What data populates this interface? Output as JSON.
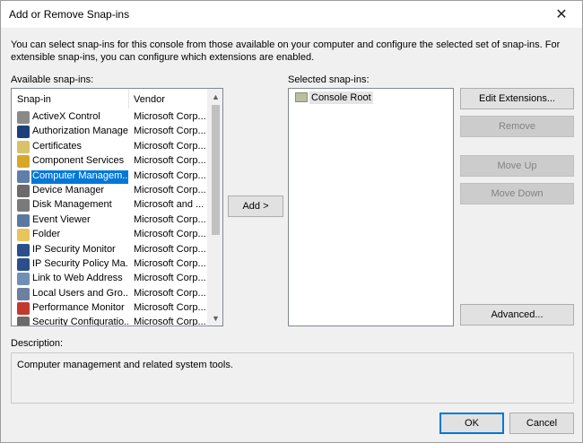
{
  "window": {
    "title": "Add or Remove Snap-ins",
    "close_glyph": "✕"
  },
  "intro": "You can select snap-ins for this console from those available on your computer and configure the selected set of snap-ins. For extensible snap-ins, you can configure which extensions are enabled.",
  "available": {
    "label": "Available snap-ins:",
    "columns": {
      "snapin": "Snap-in",
      "vendor": "Vendor"
    },
    "items": [
      {
        "name": "ActiveX Control",
        "vendor": "Microsoft Corp...",
        "icon": "activex-icon",
        "color": "#8a8a8a"
      },
      {
        "name": "Authorization Manager",
        "vendor": "Microsoft Corp...",
        "icon": "authorization-icon",
        "color": "#1f3f7a"
      },
      {
        "name": "Certificates",
        "vendor": "Microsoft Corp...",
        "icon": "certificate-icon",
        "color": "#d8c26a"
      },
      {
        "name": "Component Services",
        "vendor": "Microsoft Corp...",
        "icon": "component-icon",
        "color": "#d8a72a"
      },
      {
        "name": "Computer Managem...",
        "vendor": "Microsoft Corp...",
        "icon": "computer-management-icon",
        "color": "#5f7fa8"
      },
      {
        "name": "Device Manager",
        "vendor": "Microsoft Corp...",
        "icon": "device-manager-icon",
        "color": "#6b6b6b"
      },
      {
        "name": "Disk Management",
        "vendor": "Microsoft and ...",
        "icon": "disk-icon",
        "color": "#7a7a7a"
      },
      {
        "name": "Event Viewer",
        "vendor": "Microsoft Corp...",
        "icon": "event-viewer-icon",
        "color": "#5a78a0"
      },
      {
        "name": "Folder",
        "vendor": "Microsoft Corp...",
        "icon": "folder-icon",
        "color": "#e8c55a"
      },
      {
        "name": "IP Security Monitor",
        "vendor": "Microsoft Corp...",
        "icon": "ip-security-monitor-icon",
        "color": "#2c4f8c"
      },
      {
        "name": "IP Security Policy Ma...",
        "vendor": "Microsoft Corp...",
        "icon": "ip-security-policy-icon",
        "color": "#2c4f8c"
      },
      {
        "name": "Link to Web Address",
        "vendor": "Microsoft Corp...",
        "icon": "web-link-icon",
        "color": "#6f8fb4"
      },
      {
        "name": "Local Users and Gro...",
        "vendor": "Microsoft Corp...",
        "icon": "users-icon",
        "color": "#6e7fa0"
      },
      {
        "name": "Performance Monitor",
        "vendor": "Microsoft Corp...",
        "icon": "performance-icon",
        "color": "#c23a2f"
      },
      {
        "name": "Security Configuratio...",
        "vendor": "Microsoft Corp...",
        "icon": "security-config-icon",
        "color": "#6b6b6b"
      }
    ],
    "selected_index": 4
  },
  "add_button": "Add >",
  "selected": {
    "label": "Selected snap-ins:",
    "root": "Console Root"
  },
  "buttons": {
    "edit_extensions": "Edit Extensions...",
    "remove": "Remove",
    "move_up": "Move Up",
    "move_down": "Move Down",
    "advanced": "Advanced...",
    "ok": "OK",
    "cancel": "Cancel"
  },
  "description": {
    "label": "Description:",
    "text": "Computer management and related system tools."
  }
}
